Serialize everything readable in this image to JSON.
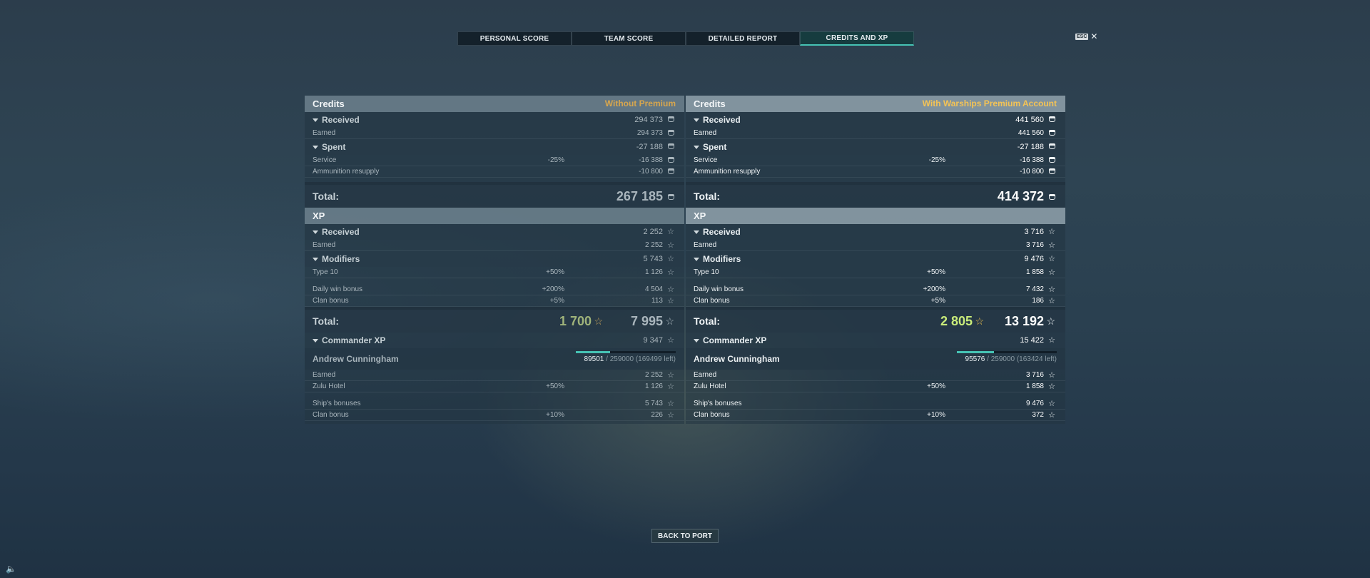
{
  "tabs": [
    "PERSONAL SCORE",
    "TEAM SCORE",
    "DETAILED REPORT",
    "CREDITS AND XP"
  ],
  "active_tab": 3,
  "esc_label": "ESC",
  "close_glyph": "✕",
  "left": {
    "credits_title": "Credits",
    "credits_side": "Without Premium",
    "received_label": "Received",
    "received_value": "294 373",
    "earned_label": "Earned",
    "earned_value": "294 373",
    "spent_label": "Spent",
    "spent_value": "-27 188",
    "service_label": "Service",
    "service_pct": "-25%",
    "service_value": "-16 388",
    "ammo_label": "Ammunition resupply",
    "ammo_value": "-10 800",
    "credits_total_label": "Total:",
    "credits_total": "267 185",
    "xp_title": "XP",
    "xp_received_label": "Received",
    "xp_received_value": "2 252",
    "xp_earned_label": "Earned",
    "xp_earned_value": "2 252",
    "modifiers_label": "Modifiers",
    "modifiers_value": "5 743",
    "type10_label": "Type 10",
    "type10_pct": "+50%",
    "type10_value": "1 126",
    "daily_label": "Daily win bonus",
    "daily_pct": "+200%",
    "daily_value": "4 504",
    "clan_label": "Clan bonus",
    "clan_pct": "+5%",
    "clan_value": "113",
    "xp_total_label": "Total:",
    "xp_total_free": "1 700",
    "xp_total": "7 995",
    "cmd_label": "Commander XP",
    "cmd_value": "9 347",
    "cmd_name": "Andrew Cunningham",
    "cmd_prog_cur": "89501",
    "cmd_prog_rest": " / 259000 (169499 left)",
    "cmd_progress": 0.3456,
    "cmd_earned_label": "Earned",
    "cmd_earned_value": "2 252",
    "zulu_label": "Zulu Hotel",
    "zulu_pct": "+50%",
    "zulu_value": "1 126",
    "ship_label": "Ship's bonuses",
    "ship_value": "5 743",
    "cclan_label": "Clan bonus",
    "cclan_pct": "+10%",
    "cclan_value": "226"
  },
  "right": {
    "credits_title": "Credits",
    "credits_side": "With Warships Premium Account",
    "received_label": "Received",
    "received_value": "441 560",
    "earned_label": "Earned",
    "earned_value": "441 560",
    "spent_label": "Spent",
    "spent_value": "-27 188",
    "service_label": "Service",
    "service_pct": "-25%",
    "service_value": "-16 388",
    "ammo_label": "Ammunition resupply",
    "ammo_value": "-10 800",
    "credits_total_label": "Total:",
    "credits_total": "414 372",
    "xp_title": "XP",
    "xp_received_label": "Received",
    "xp_received_value": "3 716",
    "xp_earned_label": "Earned",
    "xp_earned_value": "3 716",
    "modifiers_label": "Modifiers",
    "modifiers_value": "9 476",
    "type10_label": "Type 10",
    "type10_pct": "+50%",
    "type10_value": "1 858",
    "daily_label": "Daily win bonus",
    "daily_pct": "+200%",
    "daily_value": "7 432",
    "clan_label": "Clan bonus",
    "clan_pct": "+5%",
    "clan_value": "186",
    "xp_total_label": "Total:",
    "xp_total_free": "2 805",
    "xp_total": "13 192",
    "cmd_label": "Commander XP",
    "cmd_value": "15 422",
    "cmd_name": "Andrew Cunningham",
    "cmd_prog_cur": "95576",
    "cmd_prog_rest": " / 259000 (163424 left)",
    "cmd_progress": 0.369,
    "cmd_earned_label": "Earned",
    "cmd_earned_value": "3 716",
    "zulu_label": "Zulu Hotel",
    "zulu_pct": "+50%",
    "zulu_value": "1 858",
    "ship_label": "Ship's bonuses",
    "ship_value": "9 476",
    "cclan_label": "Clan bonus",
    "cclan_pct": "+10%",
    "cclan_value": "372"
  },
  "back_label": "BACK TO PORT",
  "icons": {
    "star": "☆",
    "coin": "credits-icon",
    "sound": "speaker-icon"
  }
}
